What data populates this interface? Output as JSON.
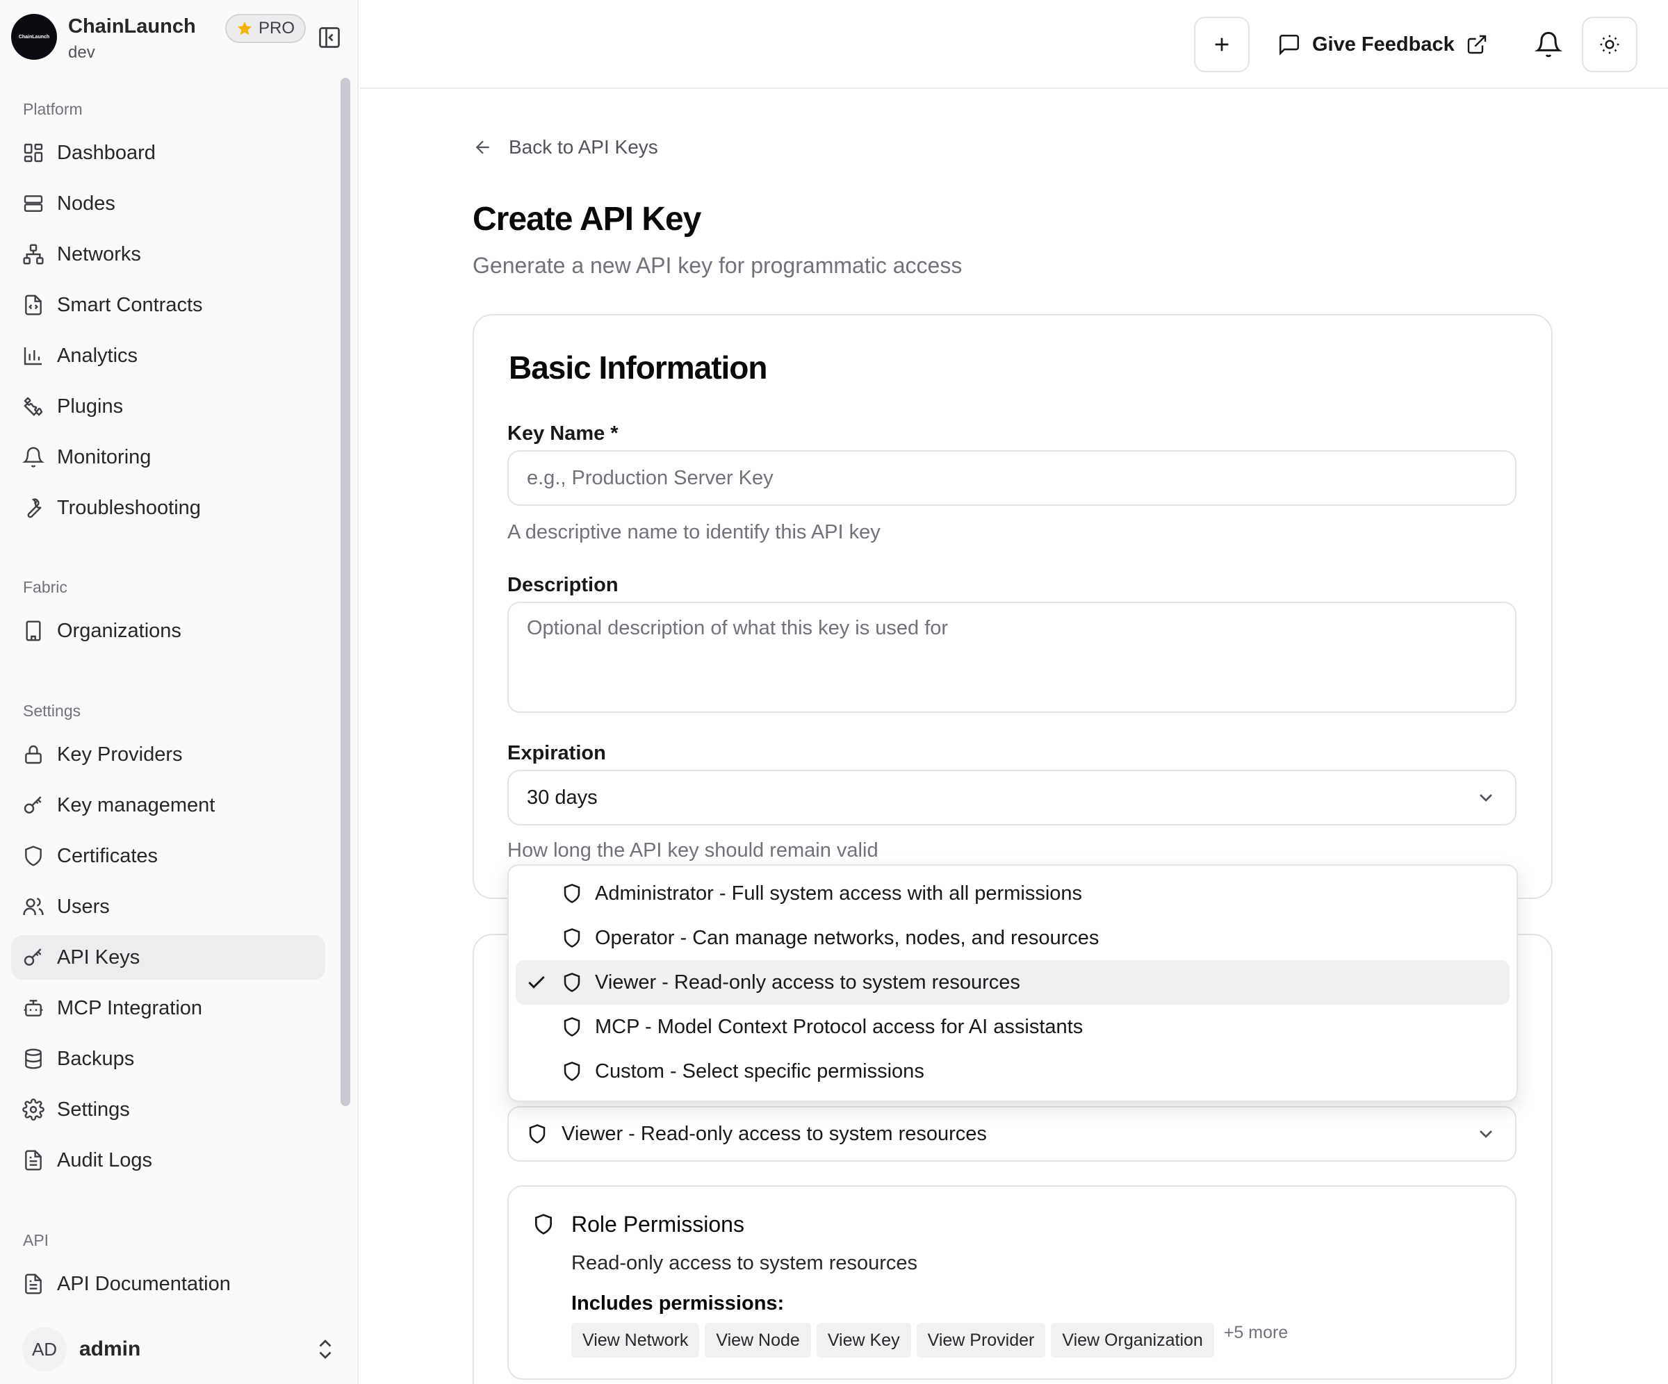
{
  "app": {
    "name": "ChainLaunch",
    "env": "dev",
    "logo_text": "ChainLaunch",
    "badge": "PRO"
  },
  "sidebar": {
    "sections": [
      {
        "label": "Platform",
        "items": [
          {
            "label": "Dashboard",
            "icon": "dashboard-icon"
          },
          {
            "label": "Nodes",
            "icon": "server-icon"
          },
          {
            "label": "Networks",
            "icon": "network-icon"
          },
          {
            "label": "Smart Contracts",
            "icon": "file-code-icon"
          },
          {
            "label": "Analytics",
            "icon": "bar-chart-icon"
          },
          {
            "label": "Plugins",
            "icon": "puzzle-icon"
          },
          {
            "label": "Monitoring",
            "icon": "bell-icon"
          },
          {
            "label": "Troubleshooting",
            "icon": "wrench-icon"
          }
        ]
      },
      {
        "label": "Fabric",
        "items": [
          {
            "label": "Organizations",
            "icon": "building-icon"
          }
        ]
      },
      {
        "label": "Settings",
        "items": [
          {
            "label": "Key Providers",
            "icon": "lock-icon"
          },
          {
            "label": "Key management",
            "icon": "key-icon"
          },
          {
            "label": "Certificates",
            "icon": "shield-icon"
          },
          {
            "label": "Users",
            "icon": "users-icon"
          },
          {
            "label": "API Keys",
            "icon": "key-icon",
            "active": true
          },
          {
            "label": "MCP Integration",
            "icon": "bot-icon"
          },
          {
            "label": "Backups",
            "icon": "database-icon"
          },
          {
            "label": "Settings",
            "icon": "gear-icon"
          },
          {
            "label": "Audit Logs",
            "icon": "file-text-icon"
          }
        ]
      },
      {
        "label": "API",
        "items": [
          {
            "label": "API Documentation",
            "icon": "file-text-icon"
          }
        ]
      }
    ],
    "user": {
      "initials": "AD",
      "name": "admin"
    }
  },
  "header": {
    "feedback_label": "Give Feedback"
  },
  "main": {
    "back_label": "Back to API Keys",
    "title": "Create API Key",
    "subtitle": "Generate a new API key for programmatic access",
    "basic": {
      "title": "Basic Information",
      "key_name_label": "Key Name *",
      "key_name_placeholder": "e.g., Production Server Key",
      "key_name_hint": "A descriptive name to identify this API key",
      "description_label": "Description",
      "description_placeholder": "Optional description of what this key is used for",
      "expiration_label": "Expiration",
      "expiration_value": "30 days",
      "expiration_hint": "How long the API key should remain valid"
    },
    "role": {
      "selected_value": "Viewer - Read-only access to system resources",
      "options": [
        {
          "label": "Administrator - Full system access with all permissions",
          "selected": false
        },
        {
          "label": "Operator - Can manage networks, nodes, and resources",
          "selected": false
        },
        {
          "label": "Viewer - Read-only access to system resources",
          "selected": true
        },
        {
          "label": "MCP - Model Context Protocol access for AI assistants",
          "selected": false
        },
        {
          "label": "Custom - Select specific permissions",
          "selected": false
        }
      ],
      "permissions_title": "Role Permissions",
      "permissions_desc": "Read-only access to system resources",
      "includes_label": "Includes permissions:",
      "tags": [
        "View Network",
        "View Node",
        "View Key",
        "View Provider",
        "View Organization"
      ],
      "more_label": "+5 more"
    }
  }
}
